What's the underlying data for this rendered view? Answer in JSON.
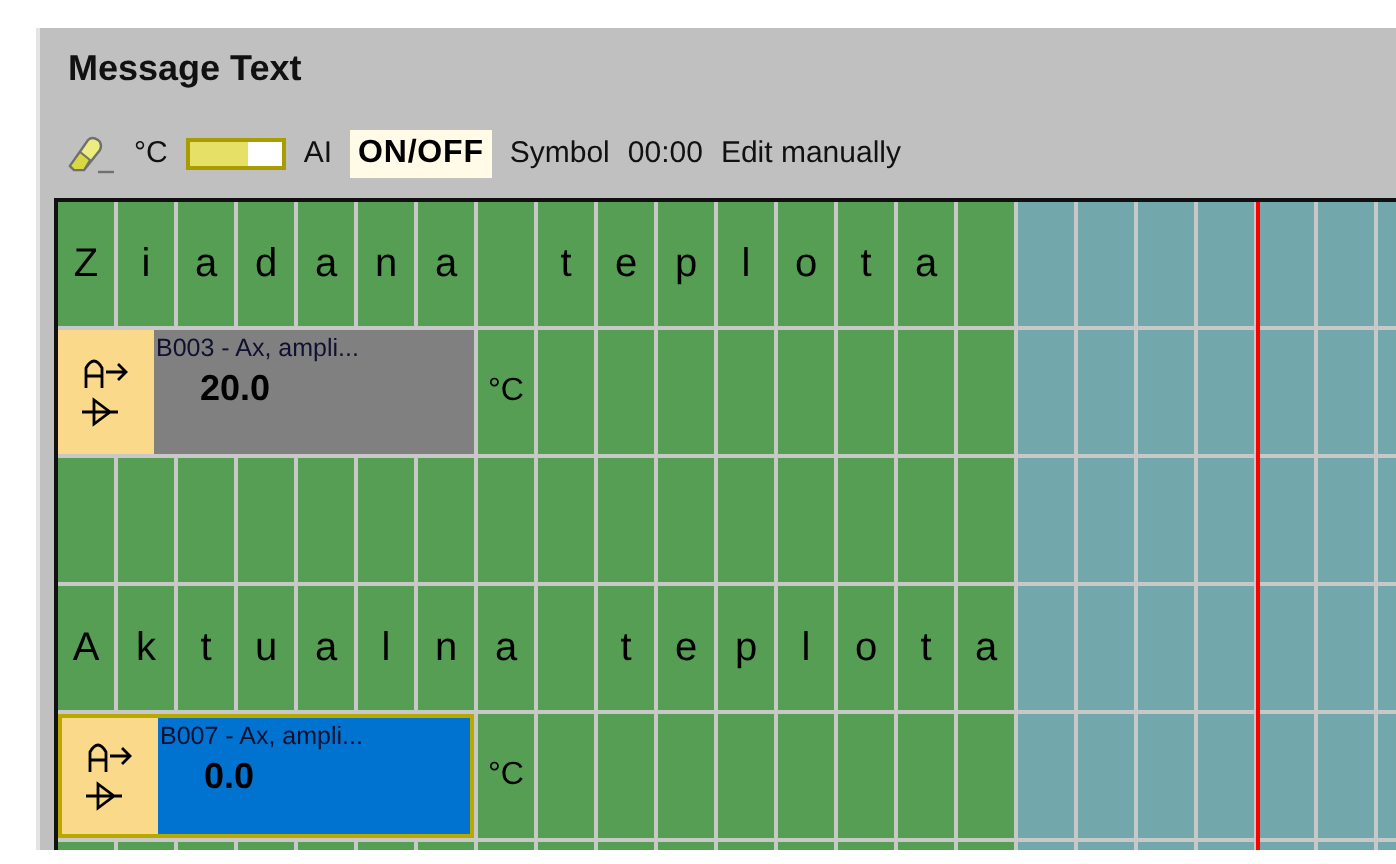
{
  "title": "Message Text",
  "toolbar": [
    {
      "kind": "eraser"
    },
    {
      "kind": "text",
      "label": "°C"
    },
    {
      "kind": "bar"
    },
    {
      "kind": "text",
      "label": "AI"
    },
    {
      "kind": "boxed",
      "label": "ON/OFF"
    },
    {
      "kind": "text",
      "label": "Symbol"
    },
    {
      "kind": "text",
      "label": "00:00"
    },
    {
      "kind": "text",
      "label": "Edit manually"
    }
  ],
  "rows": [
    {
      "kind": "text",
      "words": [
        [
          "Z",
          "i",
          "a",
          "d",
          "a",
          "n",
          "a"
        ],
        [
          "t",
          "e",
          "p",
          "l",
          "o",
          "t",
          "a"
        ]
      ]
    },
    {
      "kind": "block",
      "label": "B003 - Ax, ampli...",
      "value": "20.0",
      "unit": "°C",
      "selected": false
    },
    {
      "kind": "empty"
    },
    {
      "kind": "text",
      "words": [
        [
          "A",
          "k",
          "t",
          "u",
          "a",
          "l",
          "n",
          "a"
        ],
        [
          "t",
          "e",
          "p",
          "l",
          "o",
          "t",
          "a"
        ]
      ]
    },
    {
      "kind": "block",
      "label": "B007 - Ax, ampli...",
      "value": "0.0",
      "unit": "°C",
      "selected": true
    },
    {
      "kind": "empty"
    }
  ]
}
